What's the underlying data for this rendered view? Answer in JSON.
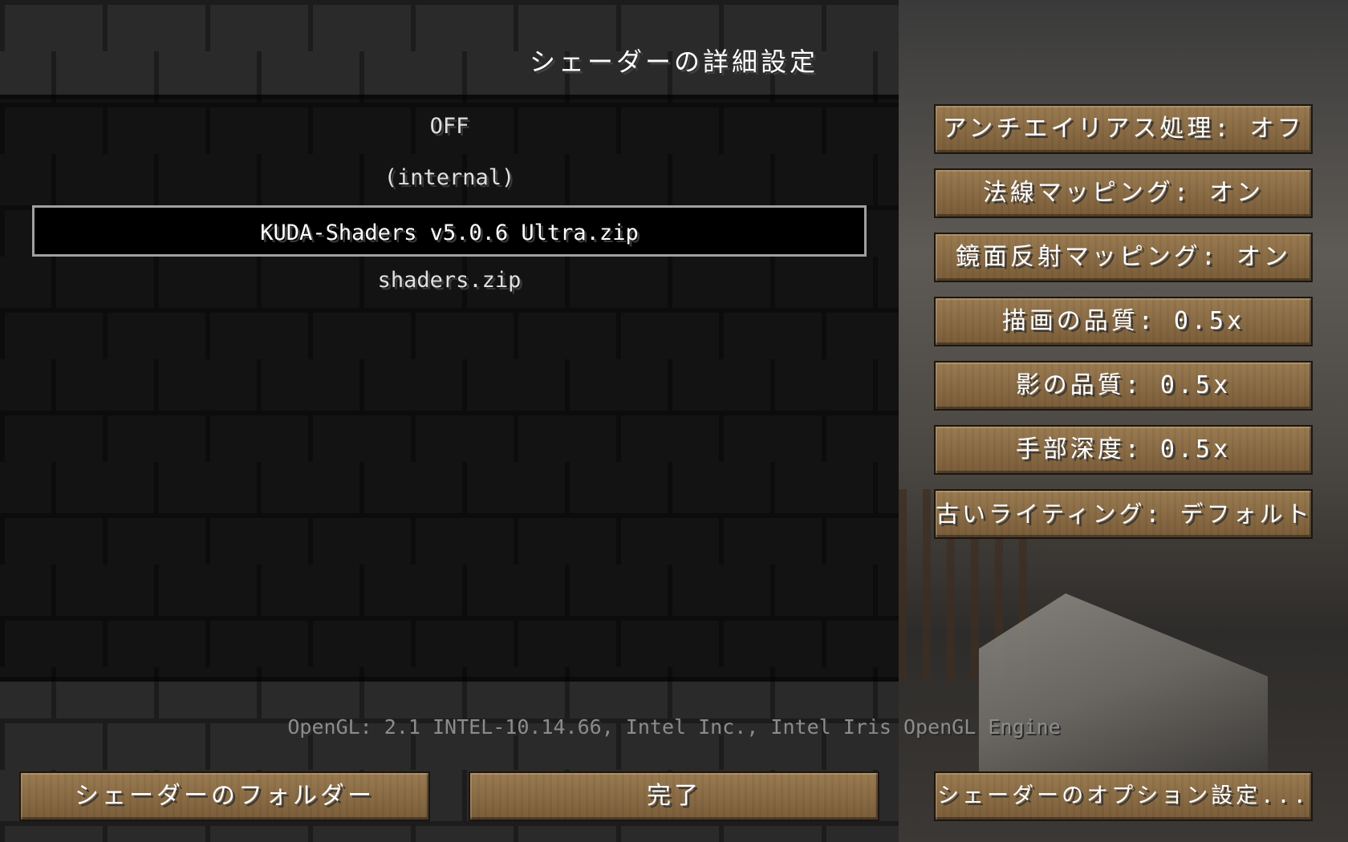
{
  "title": "シェーダーの詳細設定",
  "shader_packs": [
    {
      "label": "OFF",
      "selected": false
    },
    {
      "label": "(internal)",
      "selected": false
    },
    {
      "label": "KUDA-Shaders v5.0.6 Ultra.zip",
      "selected": true
    },
    {
      "label": "shaders.zip",
      "selected": false
    }
  ],
  "options": [
    {
      "label": "アンチエイリアス処理: オフ"
    },
    {
      "label": "法線マッピング: オン"
    },
    {
      "label": "鏡面反射マッピング: オン"
    },
    {
      "label": "描画の品質: 0.5x"
    },
    {
      "label": "影の品質: 0.5x"
    },
    {
      "label": "手部深度: 0.5x"
    },
    {
      "label": "古いライティング: デフォルト"
    }
  ],
  "opengl_info": "OpenGL: 2.1 INTEL-10.14.66, Intel Inc., Intel Iris OpenGL Engine",
  "bottom": {
    "folder_label": "シェーダーのフォルダー",
    "done_label": "完了",
    "options_label": "シェーダーのオプション設定..."
  }
}
